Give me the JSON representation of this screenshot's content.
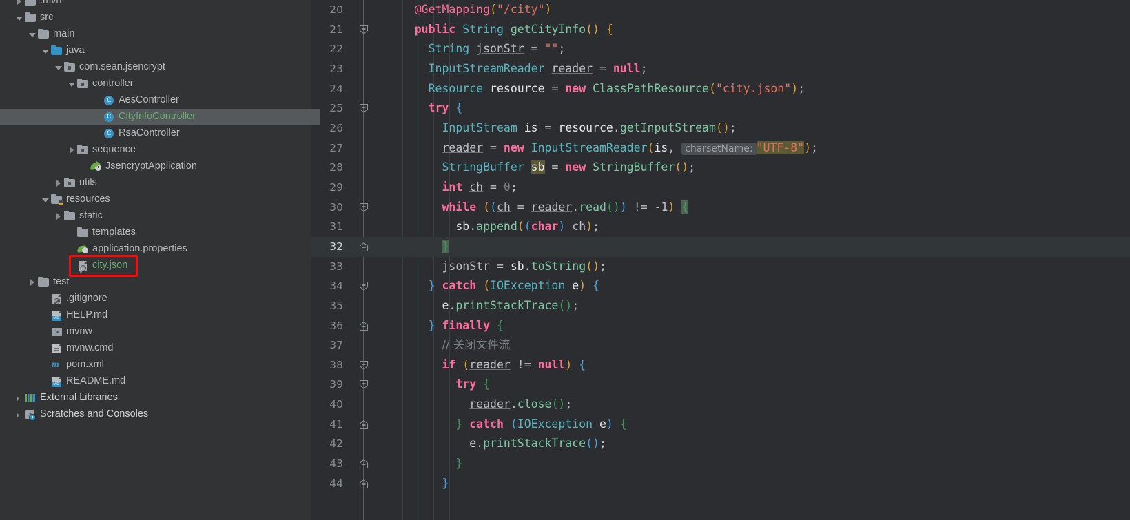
{
  "sidebar": {
    "rows": [
      {
        "indent": 1,
        "twisty": "right",
        "icon": "folder-gray",
        "label": ".mvn",
        "partial": true
      },
      {
        "indent": 1,
        "twisty": "down",
        "icon": "folder-gray",
        "label": "src"
      },
      {
        "indent": 2,
        "twisty": "down",
        "icon": "folder-gray",
        "label": "main"
      },
      {
        "indent": 3,
        "twisty": "down",
        "icon": "folder-blue",
        "label": "java"
      },
      {
        "indent": 4,
        "twisty": "down",
        "icon": "folder-pkg",
        "label": "com.sean.jsencrypt"
      },
      {
        "indent": 5,
        "twisty": "down",
        "icon": "folder-pkg",
        "label": "controller"
      },
      {
        "indent": 7,
        "twisty": "none",
        "icon": "class",
        "label": "AesController"
      },
      {
        "indent": 7,
        "twisty": "none",
        "icon": "class",
        "label": "CityInfoController",
        "selected": true,
        "color": "green"
      },
      {
        "indent": 7,
        "twisty": "none",
        "icon": "class",
        "label": "RsaController"
      },
      {
        "indent": 5,
        "twisty": "right",
        "icon": "folder-pkg",
        "label": "sequence"
      },
      {
        "indent": 6,
        "twisty": "none",
        "icon": "spring-bean",
        "label": "JsencryptApplication"
      },
      {
        "indent": 4,
        "twisty": "right",
        "icon": "folder-pkg",
        "label": "utils"
      },
      {
        "indent": 3,
        "twisty": "down",
        "icon": "folder-res",
        "label": "resources"
      },
      {
        "indent": 4,
        "twisty": "right",
        "icon": "folder-gray",
        "label": "static"
      },
      {
        "indent": 5,
        "twisty": "none",
        "icon": "folder-gray",
        "label": "templates"
      },
      {
        "indent": 5,
        "twisty": "none",
        "icon": "properties",
        "label": "application.properties"
      },
      {
        "indent": 5,
        "twisty": "none",
        "icon": "json-file",
        "label": "city.json",
        "color": "green",
        "annotated": true
      },
      {
        "indent": 2,
        "twisty": "right",
        "icon": "folder-gray",
        "label": "test"
      },
      {
        "indent": 3,
        "twisty": "none",
        "icon": "gitignore",
        "label": ".gitignore"
      },
      {
        "indent": 3,
        "twisty": "none",
        "icon": "markdown",
        "label": "HELP.md"
      },
      {
        "indent": 3,
        "twisty": "none",
        "icon": "shell",
        "label": "mvnw"
      },
      {
        "indent": 3,
        "twisty": "none",
        "icon": "cmd",
        "label": "mvnw.cmd"
      },
      {
        "indent": 3,
        "twisty": "none",
        "icon": "maven",
        "label": "pom.xml"
      },
      {
        "indent": 3,
        "twisty": "none",
        "icon": "markdown",
        "label": "README.md"
      },
      {
        "indent": 1,
        "twisty": "small-right",
        "icon": "external-libraries",
        "label": "External Libraries",
        "color": "white"
      },
      {
        "indent": 1,
        "twisty": "small-right",
        "icon": "scratches",
        "label": "Scratches and Consoles",
        "color": "white"
      }
    ],
    "annotation": {
      "color": "#fa0a0a",
      "target": "city.json"
    }
  },
  "editor": {
    "first_line_number": 20,
    "caret_line_number": 32,
    "lines": [
      {
        "n": 20,
        "text": "@GetMapping(\"/city\")"
      },
      {
        "n": 21,
        "text": "public String getCityInfo() {",
        "fold": "start"
      },
      {
        "n": 22,
        "text": "String jsonStr = \"\";"
      },
      {
        "n": 23,
        "text": "InputStreamReader reader = null;"
      },
      {
        "n": 24,
        "text": "Resource resource = new ClassPathResource(\"city.json\");"
      },
      {
        "n": 25,
        "text": "try {",
        "fold": "start"
      },
      {
        "n": 26,
        "text": "InputStream is = resource.getInputStream();"
      },
      {
        "n": 27,
        "text": "reader = new InputStreamReader(is, charsetName: \"UTF-8\");",
        "hint": "charsetName:",
        "highlight": "\"UTF-8\""
      },
      {
        "n": 28,
        "text": "StringBuffer sb = new StringBuffer();"
      },
      {
        "n": 29,
        "text": "int ch = 0;"
      },
      {
        "n": 30,
        "text": "while ((ch = reader.read()) != -1) {",
        "fold": "start"
      },
      {
        "n": 31,
        "text": "sb.append((char) ch);"
      },
      {
        "n": 32,
        "text": "}",
        "fold": "end",
        "caret": true
      },
      {
        "n": 33,
        "text": "jsonStr = sb.toString();"
      },
      {
        "n": 34,
        "text": "} catch (IOException e) {",
        "fold": "start"
      },
      {
        "n": 35,
        "text": "e.printStackTrace();"
      },
      {
        "n": 36,
        "text": "} finally {",
        "fold": "end"
      },
      {
        "n": 37,
        "text": "// 关闭文件流"
      },
      {
        "n": 38,
        "text": "if (reader != null) {",
        "fold": "start"
      },
      {
        "n": 39,
        "text": "try {",
        "fold": "start"
      },
      {
        "n": 40,
        "text": "reader.close();"
      },
      {
        "n": 41,
        "text": "} catch (IOException e) {",
        "fold": "end"
      },
      {
        "n": 42,
        "text": "e.printStackTrace();"
      },
      {
        "n": 43,
        "text": "}",
        "fold": "end"
      },
      {
        "n": 44,
        "text": "}",
        "fold": "end"
      }
    ],
    "parameter_hint": "charsetName:",
    "highlighted_string": "\"UTF-8\"",
    "comment_text": "// 关闭文件流"
  },
  "colors": {
    "sidebar_bg": "#313335",
    "editor_bg": "#2b2d30",
    "selection_bg": "#55595b",
    "caret_line_bg": "#323639",
    "annotation_red": "#fa0a0a",
    "keyword": "#ff6b9d",
    "string": "#e8705a",
    "type": "#56b6c2",
    "method": "#7ec9a4",
    "comment": "#7a7f84",
    "vcs_added_green": "#6aab73",
    "string_highlight_bg": "#5c5a35",
    "hint_bg": "#4b4f52"
  }
}
